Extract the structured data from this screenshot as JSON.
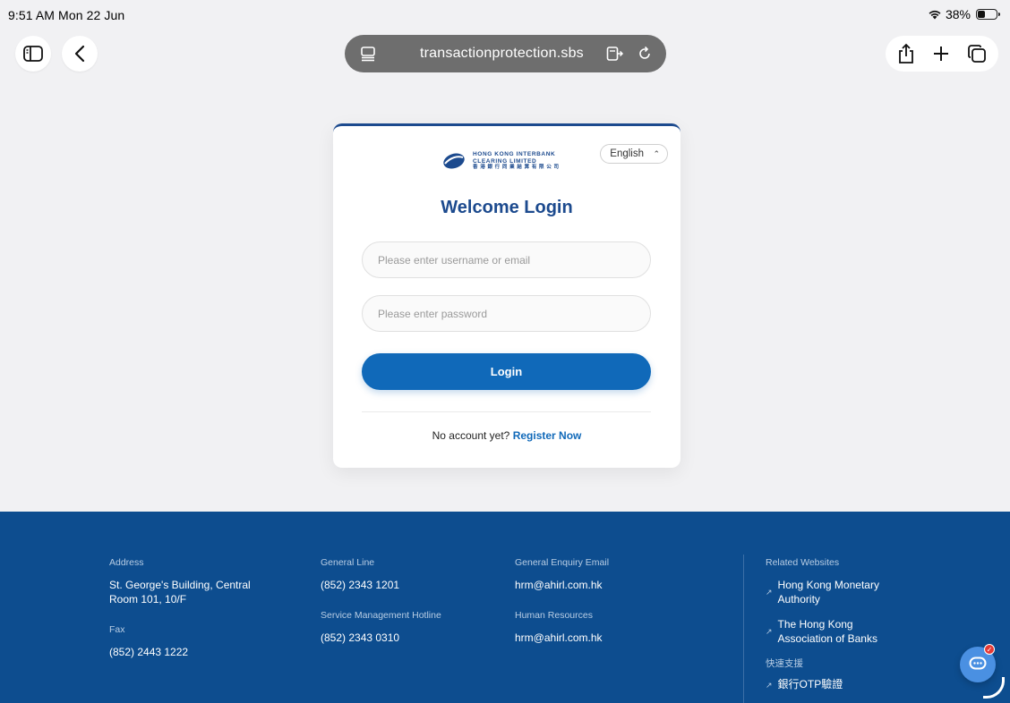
{
  "status_bar": {
    "time": "9:51 AM  Mon 22 Jun",
    "battery": "38%",
    "battery_level": 0.38
  },
  "browser": {
    "url": "transactionprotection.sbs",
    "icons": [
      "sidebar-icon",
      "back-icon",
      "tab-icon",
      "reader-icon",
      "reload-icon",
      "share-icon",
      "new-tab-icon",
      "tabs-overview-icon"
    ]
  },
  "login_card": {
    "language": "English",
    "logo_line1": "HONG KONG INTERBANK",
    "logo_line2": "CLEARING LIMITED",
    "logo_line3": "香 港 銀 行 同 業 結 算 有 限 公 司",
    "title": "Welcome Login",
    "username_placeholder": "Please enter username or email",
    "password_placeholder": "Please enter password",
    "login_button": "Login",
    "no_account_text": "No account yet?",
    "register_link": "Register Now"
  },
  "footer": {
    "address_label": "Address",
    "address_line1": "St. George's Building, Central",
    "address_line2": "Room 101, 10/F",
    "fax_label": "Fax",
    "fax_value": "(852) 2443 1222",
    "general_line_label": "General Line",
    "general_line_value": "(852) 2343 1201",
    "service_hotline_label": "Service Management Hotline",
    "service_hotline_value": "(852) 2343 0310",
    "enquiry_email_label": "General Enquiry Email",
    "enquiry_email_value": "hrm@ahirl.com.hk",
    "hr_label": "Human Resources",
    "hr_value": "hrm@ahirl.com.hk",
    "related_label": "Related Websites",
    "related_links": [
      {
        "line1": "Hong Kong Monetary",
        "line2": "Authority"
      },
      {
        "line1": "The Hong Kong",
        "line2": "Association of Banks"
      }
    ],
    "quick_support_label": "快速支援",
    "quick_support_link": "銀行OTP驗證"
  },
  "colors": {
    "brand_blue": "#1c4a8e",
    "button_blue": "#1069b9",
    "footer_bg": "#0d4d8f",
    "chat_blue": "#4a90e2"
  }
}
